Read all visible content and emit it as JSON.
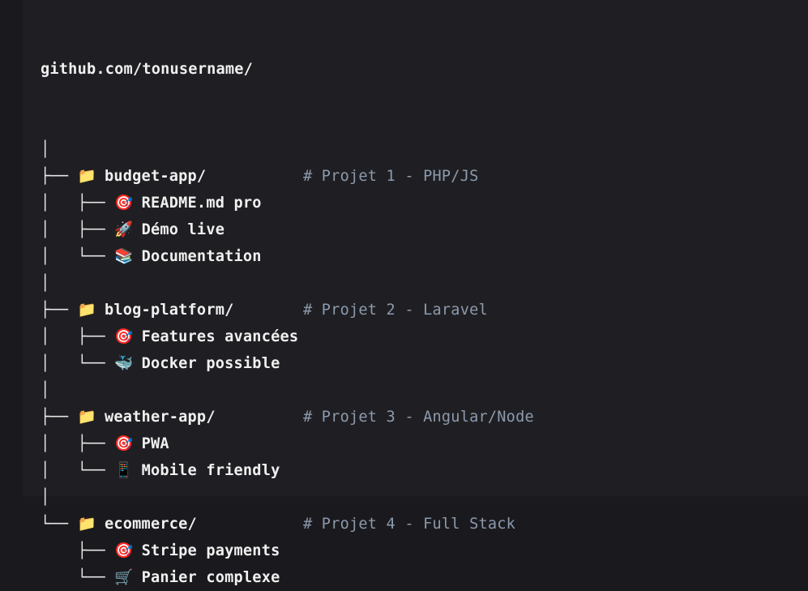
{
  "root": "github.com/tonusername/",
  "rows": [
    {
      "prefix": "│"
    },
    {
      "prefix": "├── ",
      "icon": "📁",
      "icon_name": "folder-icon",
      "label": "budget-app/",
      "comment": "# Projet 1 - PHP/JS"
    },
    {
      "prefix": "│   ├── ",
      "icon": "🎯",
      "icon_name": "target-icon",
      "label": "README.md pro"
    },
    {
      "prefix": "│   ├── ",
      "icon": "🚀",
      "icon_name": "rocket-icon",
      "label": "Démo live"
    },
    {
      "prefix": "│   └── ",
      "icon": "📚",
      "icon_name": "books-icon",
      "label": "Documentation"
    },
    {
      "prefix": "│"
    },
    {
      "prefix": "├── ",
      "icon": "📁",
      "icon_name": "folder-icon",
      "label": "blog-platform/",
      "comment": "# Projet 2 - Laravel"
    },
    {
      "prefix": "│   ├── ",
      "icon": "🎯",
      "icon_name": "target-icon",
      "label": "Features avancées"
    },
    {
      "prefix": "│   └── ",
      "icon": "🐳",
      "icon_name": "whale-icon",
      "label": "Docker possible"
    },
    {
      "prefix": "│"
    },
    {
      "prefix": "├── ",
      "icon": "📁",
      "icon_name": "folder-icon",
      "label": "weather-app/",
      "comment": "# Projet 3 - Angular/Node"
    },
    {
      "prefix": "│   ├── ",
      "icon": "🎯",
      "icon_name": "target-icon",
      "label": "PWA"
    },
    {
      "prefix": "│   └── ",
      "icon": "📱",
      "icon_name": "mobile-icon",
      "label": "Mobile friendly"
    },
    {
      "prefix": "│"
    },
    {
      "prefix": "└── ",
      "icon": "📁",
      "icon_name": "folder-icon",
      "label": "ecommerce/",
      "comment": "# Projet 4 - Full Stack"
    },
    {
      "prefix": "    ├── ",
      "icon": "🎯",
      "icon_name": "target-icon",
      "label": "Stripe payments"
    },
    {
      "prefix": "    └── ",
      "icon": "🛒",
      "icon_name": "cart-icon",
      "label": "Panier complexe"
    }
  ]
}
